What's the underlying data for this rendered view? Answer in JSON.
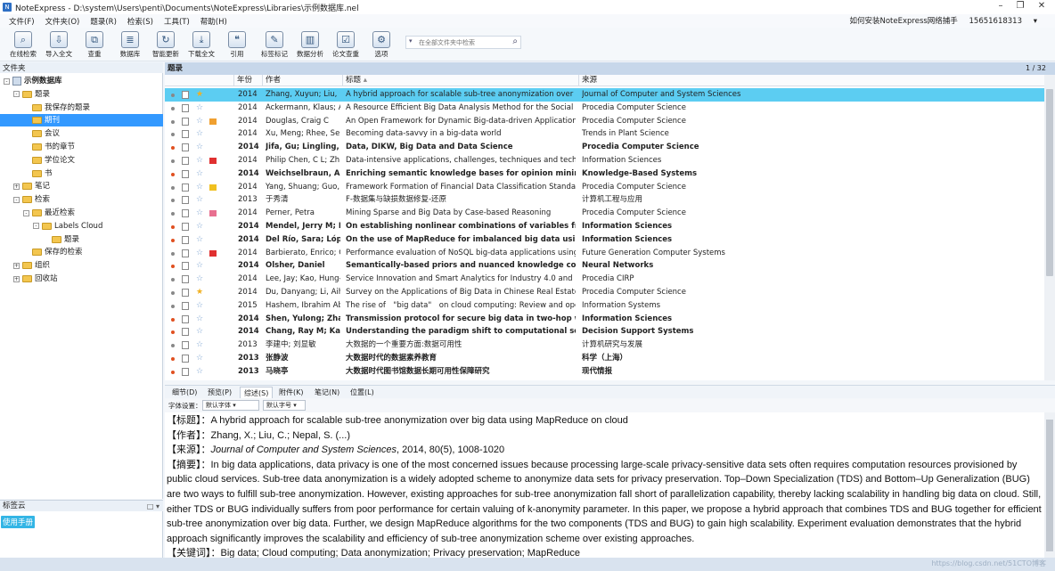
{
  "window": {
    "app": "NoteExpress",
    "path": "D:\\system\\Users\\penti\\Documents\\NoteExpress\\Libraries\\示例数据库.nel"
  },
  "menu": [
    "文件(F)",
    "文件夹(O)",
    "题录(R)",
    "检索(S)",
    "工具(T)",
    "帮助(H)"
  ],
  "menu_right": {
    "help_link": "如何安装NoteExpress网络捕手",
    "account": "15651618313"
  },
  "toolbar": [
    {
      "label": "在线检索",
      "icon": "search-online-icon"
    },
    {
      "label": "导入全文",
      "icon": "import-fulltext-icon"
    },
    {
      "label": "查重",
      "icon": "duplicate-check-icon"
    },
    {
      "label": "数据库",
      "icon": "database-icon"
    },
    {
      "label": "智能更新",
      "icon": "smart-update-icon"
    },
    {
      "label": "下载全文",
      "icon": "download-icon"
    },
    {
      "label": "引用",
      "icon": "cite-icon"
    },
    {
      "label": "标签标记",
      "icon": "tag-icon"
    },
    {
      "label": "数据分析",
      "icon": "chart-icon"
    },
    {
      "label": "论文查重",
      "icon": "paper-check-icon"
    },
    {
      "label": "选项",
      "icon": "options-icon"
    }
  ],
  "search": {
    "placeholder": "在全部文件夹中检索"
  },
  "left": {
    "header": "文件夹",
    "tree": [
      {
        "label": "示例数据库",
        "level": 0,
        "bold": true,
        "kind": "db",
        "expander": "-"
      },
      {
        "label": "题录",
        "level": 1,
        "kind": "folder",
        "expander": "-"
      },
      {
        "label": "我保存的题录",
        "level": 2,
        "kind": "folder"
      },
      {
        "label": "期刊",
        "level": 2,
        "kind": "folder",
        "selected": true
      },
      {
        "label": "会议",
        "level": 2,
        "kind": "folder"
      },
      {
        "label": "书的章节",
        "level": 2,
        "kind": "folder"
      },
      {
        "label": "学位论文",
        "level": 2,
        "kind": "folder"
      },
      {
        "label": "书",
        "level": 2,
        "kind": "folder"
      },
      {
        "label": "笔记",
        "level": 1,
        "kind": "folder",
        "expander": "+"
      },
      {
        "label": "检索",
        "level": 1,
        "kind": "folder",
        "expander": "-"
      },
      {
        "label": "最近检索",
        "level": 2,
        "kind": "folder",
        "expander": "-"
      },
      {
        "label": "Labels Cloud",
        "level": 3,
        "kind": "folder",
        "expander": "-"
      },
      {
        "label": "题录",
        "level": 4,
        "kind": "folder"
      },
      {
        "label": "保存的检索",
        "level": 2,
        "kind": "folder"
      },
      {
        "label": "组织",
        "level": 1,
        "kind": "folder",
        "expander": "+"
      },
      {
        "label": "回收站",
        "level": 1,
        "kind": "folder",
        "expander": "+"
      }
    ],
    "tags_header": "标签云",
    "tags": [
      "使用手册"
    ]
  },
  "list": {
    "header": "题录",
    "page": "1 / 32",
    "columns": [
      "年份",
      "作者",
      "标题",
      "来源"
    ],
    "rows": [
      {
        "dot": "#888",
        "flag": "",
        "star": "gold",
        "year": "2014",
        "author": "Zhang, Xuyun; Liu, ...",
        "title": "A hybrid approach for scalable sub-tree anonymization over big d...",
        "source": "Journal of Computer and System Sciences",
        "bold": false,
        "selected": true
      },
      {
        "dot": "#888",
        "flag": "",
        "star": "",
        "year": "2014",
        "author": "Ackermann, Klaus; A...",
        "title": "A Resource Efficient Big Data Analysis Method for the Social Scien...",
        "source": "Procedia Computer Science",
        "bold": false
      },
      {
        "dot": "#888",
        "flag": "#f0a030",
        "star": "",
        "year": "2014",
        "author": "Douglas, Craig C",
        "title": "An Open Framework for Dynamic Big-data-driven Application Sys...",
        "source": "Procedia Computer Science",
        "bold": false
      },
      {
        "dot": "#888",
        "flag": "",
        "star": "",
        "year": "2014",
        "author": "Xu, Meng; Rhee, Se...",
        "title": "Becoming data-savvy in a big-data world",
        "source": "Trends in Plant Science",
        "bold": false
      },
      {
        "dot": "#e05020",
        "flag": "",
        "star": "",
        "year": "2014",
        "author": "Jifa, Gu; Lingling, Zh",
        "title": "Data, DIKW, Big Data and Data Science",
        "source": "Procedia Computer Science",
        "bold": true
      },
      {
        "dot": "#888",
        "flag": "#e03030",
        "star": "",
        "year": "2014",
        "author": "Philip Chen, C L; Zh...",
        "title": "Data-intensive applications, challenges, techniques and technologi...",
        "source": "Information Sciences",
        "bold": false
      },
      {
        "dot": "#e05020",
        "flag": "",
        "star": "",
        "year": "2014",
        "author": "Weichselbraun, A; G",
        "title": "Enriching semantic knowledge bases for opinion mining in big",
        "source": "Knowledge-Based Systems",
        "bold": true
      },
      {
        "dot": "#888",
        "flag": "#f0c020",
        "star": "",
        "year": "2014",
        "author": "Yang, Shuang; Guo, ...",
        "title": "Framework Formation of Financial Data Classification Standard in ...",
        "source": "Procedia Computer Science",
        "bold": false
      },
      {
        "dot": "#888",
        "flag": "",
        "star": "",
        "year": "2013",
        "author": "于秀清",
        "title": "F-数据集与缺损数据修复-还原",
        "source": "计算机工程与应用",
        "bold": false
      },
      {
        "dot": "#888",
        "flag": "#e87090",
        "star": "",
        "year": "2014",
        "author": "Perner, Petra",
        "title": "Mining Sparse and Big Data by Case-based Reasoning",
        "source": "Procedia Computer Science",
        "bold": false
      },
      {
        "dot": "#e05020",
        "flag": "",
        "star": "",
        "year": "2014",
        "author": "Mendel, Jerry M; Ko",
        "title": "On establishing nonlinear combinations of variables from smal",
        "source": "Information Sciences",
        "bold": true
      },
      {
        "dot": "#e05020",
        "flag": "",
        "star": "",
        "year": "2014",
        "author": "Del Río, Sara; López",
        "title": "On the use of MapReduce for imbalanced big data using Rand",
        "source": "Information Sciences",
        "bold": true
      },
      {
        "dot": "#888",
        "flag": "#e03030",
        "star": "",
        "year": "2014",
        "author": "Barbierato, Enrico; G...",
        "title": "Performance evaluation of NoSQL big-data applications using mu...",
        "source": "Future Generation Computer Systems",
        "bold": false
      },
      {
        "dot": "#e05020",
        "flag": "",
        "star": "",
        "year": "2014",
        "author": "Olsher, Daniel",
        "title": "Semantically-based priors and nuanced knowledge core for Bi",
        "source": "Neural Networks",
        "bold": true
      },
      {
        "dot": "#888",
        "flag": "",
        "star": "",
        "year": "2014",
        "author": "Lee, Jay; Kao, Hung-...",
        "title": "Service Innovation and Smart Analytics for Industry 4.0 and Big Da...",
        "source": "Procedia CIRP",
        "bold": false
      },
      {
        "dot": "#888",
        "flag": "",
        "star": "gold",
        "year": "2014",
        "author": "Du, Danyang; Li, Aih...",
        "title": "Survey on the Applications of Big Data in Chinese Real Estate Ente...",
        "source": "Procedia Computer Science",
        "bold": false
      },
      {
        "dot": "#888",
        "flag": "",
        "star": "",
        "year": "2015",
        "author": "Hashem, Ibrahim Ab...",
        "title": "The rise of　\"big data\"　on cloud computing: Review and open res...",
        "source": "Information Systems",
        "bold": false
      },
      {
        "dot": "#e05020",
        "flag": "",
        "star": "",
        "year": "2014",
        "author": "Shen, Yulong; Zhan...",
        "title": "Transmission protocol for secure big data in two-hop wireless",
        "source": "Information Sciences",
        "bold": true
      },
      {
        "dot": "#e05020",
        "flag": "",
        "star": "",
        "year": "2014",
        "author": "Chang, Ray M; Kauf.",
        "title": "Understanding the paradigm shift to computational social scie",
        "source": "Decision Support Systems",
        "bold": true
      },
      {
        "dot": "#888",
        "flag": "",
        "star": "",
        "year": "2013",
        "author": "李建中; 刘显敏",
        "title": "大数据的一个重要方面:数据可用性",
        "source": "计算机研究与发展",
        "bold": false
      },
      {
        "dot": "#e05020",
        "flag": "",
        "star": "",
        "year": "2013",
        "author": "张静波",
        "title": "大数据时代的数据素养教育",
        "source": "科学（上海）",
        "bold": true
      },
      {
        "dot": "#e05020",
        "flag": "",
        "star": "",
        "year": "2013",
        "author": "马晓亭",
        "title": "大数据时代图书馆数据长期可用性保障研究",
        "source": "现代情报",
        "bold": true
      }
    ]
  },
  "detail": {
    "tabs": [
      "细节(D)",
      "预览(P)",
      "综述(S)",
      "附件(K)",
      "笔记(N)",
      "位置(L)"
    ],
    "active_tab": 2,
    "font_label": "字体设置：",
    "font_name": "默认字体",
    "font_size": "默认字号",
    "title_line": "【标题】：A hybrid approach for scalable sub-tree anonymization over big data using MapReduce on cloud",
    "authors_line": "【作者】：Zhang, X.; Liu, C.; Nepal, S. (...)",
    "source_label": "【来源】：",
    "source_journal": "Journal of Computer and System Sciences",
    "source_rest": ", 2014, 80(5), 1008-1020",
    "abstract_line": "【摘要】：In big data applications, data privacy is one of the most concerned issues because processing large-scale privacy-sensitive data sets often requires computation resources provisioned by public cloud services. Sub-tree data anonymization is a widely adopted scheme to anonymize data sets for privacy preservation. Top–Down Specialization (TDS) and Bottom–Up Generalization (BUG) are two ways to fulfill sub-tree anonymization. However, existing approaches for sub-tree anonymization fall short of parallelization capability, thereby lacking scalability in handling big data on cloud. Still, either TDS or BUG individually suffers from poor performance for certain valuing of k-anonymity parameter. In this paper, we propose a hybrid approach that combines TDS and BUG together for efficient sub-tree anonymization over big data. Further, we design MapReduce algorithms for the two components (TDS and BUG) to gain high scalability. Experiment evaluation demonstrates that the hybrid approach significantly improves the scalability and efficiency of sub-tree anonymization scheme over existing approaches.",
    "keywords_line": "【关键词】：Big data; Cloud computing; Data anonymization; Privacy preservation; MapReduce"
  },
  "status": {
    "watermark": "https://blog.csdn.net/51CTO博客"
  }
}
